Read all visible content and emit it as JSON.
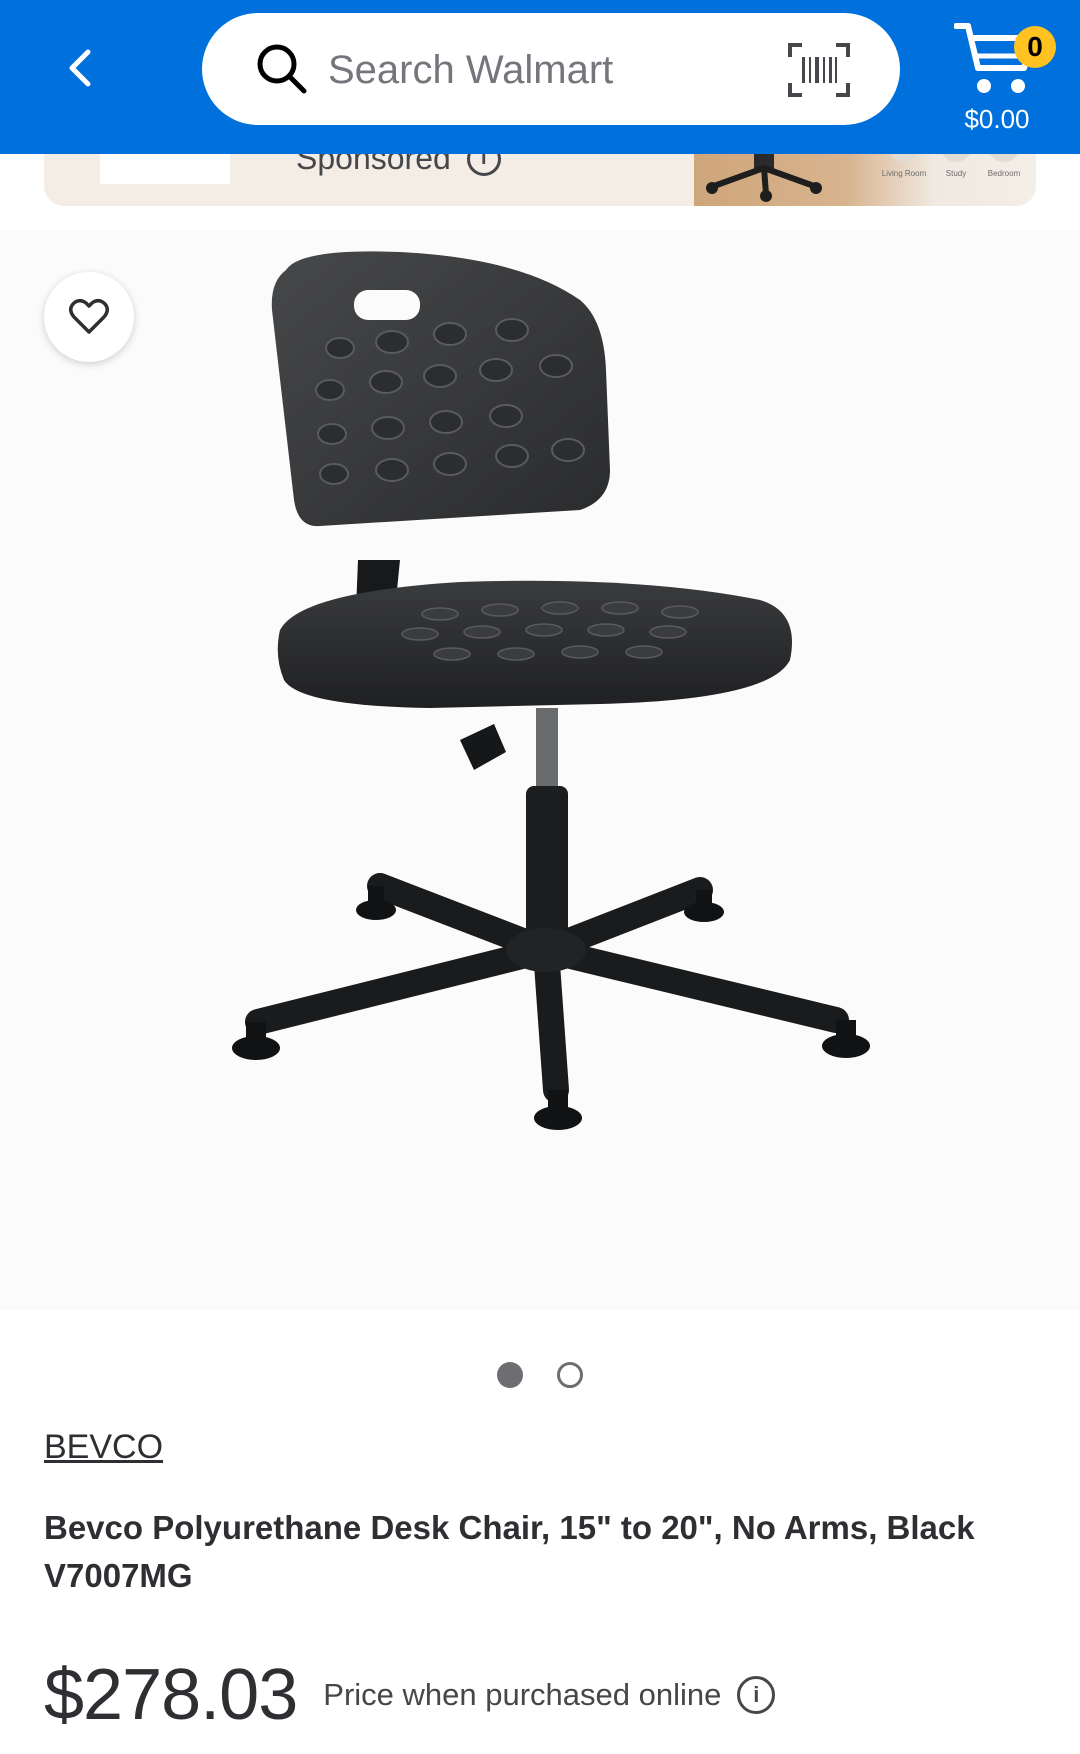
{
  "header": {
    "search_placeholder": "Search Walmart",
    "cart_count": "0",
    "cart_total": "$0.00",
    "accent_color": "#0071dc",
    "badge_color": "#ffc220",
    "icons": [
      "chevron-left-icon",
      "search-icon",
      "barcode-scanner-icon",
      "cart-icon"
    ]
  },
  "banner": {
    "sponsored_label": "Sponsored",
    "info_glyph": "i",
    "image_captions": [
      "Living Room",
      "Study",
      "Bedroom"
    ]
  },
  "product": {
    "image_alt": "black polyurethane desk chair on five-star base",
    "carousel_total": 2,
    "carousel_active": 1,
    "brand": "BEVCO",
    "title": "Bevco Polyurethane Desk Chair, 15\" to 20\", No Arms, Black V7007MG",
    "price": "$278.03",
    "price_note": "Price when purchased online",
    "price_info_glyph": "i"
  }
}
